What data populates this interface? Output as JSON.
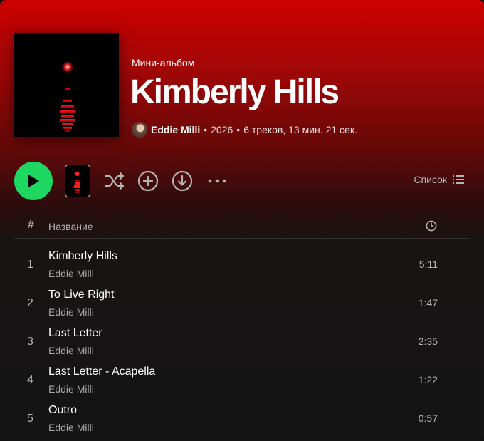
{
  "album": {
    "type_label": "Мини-альбом",
    "title": "Kimberly Hills",
    "artist": "Eddie Milli",
    "separator": "•",
    "year": "2026",
    "summary": "6 треков, 13 мин. 21 сек."
  },
  "actions": {
    "play_icon": "play-icon",
    "shuffle_icon": "shuffle-icon",
    "add_icon": "add-circle-icon",
    "download_icon": "download-icon",
    "more_icon": "more-icon",
    "view_label": "Список",
    "view_icon": "list-icon"
  },
  "table": {
    "col_number": "#",
    "col_title": "Название",
    "col_duration_icon": "clock-icon",
    "tracks": [
      {
        "number": "1",
        "title": "Kimberly Hills",
        "artist": "Eddie Milli",
        "duration": "5:11"
      },
      {
        "number": "2",
        "title": "To Live Right",
        "artist": "Eddie Milli",
        "duration": "1:47"
      },
      {
        "number": "3",
        "title": "Last Letter",
        "artist": "Eddie Milli",
        "duration": "2:35"
      },
      {
        "number": "4",
        "title": "Last Letter - Acapella",
        "artist": "Eddie Milli",
        "duration": "1:22"
      },
      {
        "number": "5",
        "title": "Outro",
        "artist": "Eddie Milli",
        "duration": "0:57"
      }
    ]
  },
  "colors": {
    "accent_green": "#1ed760",
    "header_red": "#cc0000",
    "background": "#121212"
  }
}
